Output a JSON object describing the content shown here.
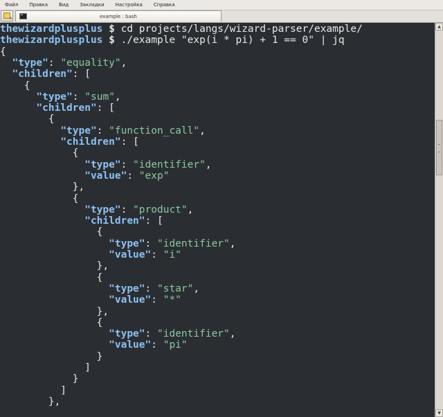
{
  "menu": [
    "Файл",
    "Правка",
    "Вид",
    "Закладки",
    "Настройка",
    "Справка"
  ],
  "tab": {
    "title": "example : bash"
  },
  "terminal": {
    "prompt": "thewizardplusplus",
    "commands": [
      "cd projects/langs/wizard-parser/example/",
      "./example \"exp(i * pi) + 1 == 0\" | jq"
    ],
    "output": [
      [
        [
          "p",
          "{"
        ]
      ],
      [
        [
          "p",
          "  "
        ],
        [
          "k",
          "\"type\""
        ],
        [
          "p",
          ": "
        ],
        [
          "s",
          "\"equality\""
        ],
        [
          "p",
          ","
        ]
      ],
      [
        [
          "p",
          "  "
        ],
        [
          "k",
          "\"children\""
        ],
        [
          "p",
          ": ["
        ]
      ],
      [
        [
          "p",
          "    {"
        ]
      ],
      [
        [
          "p",
          "      "
        ],
        [
          "k",
          "\"type\""
        ],
        [
          "p",
          ": "
        ],
        [
          "s",
          "\"sum\""
        ],
        [
          "p",
          ","
        ]
      ],
      [
        [
          "p",
          "      "
        ],
        [
          "k",
          "\"children\""
        ],
        [
          "p",
          ": ["
        ]
      ],
      [
        [
          "p",
          "        {"
        ]
      ],
      [
        [
          "p",
          "          "
        ],
        [
          "k",
          "\"type\""
        ],
        [
          "p",
          ": "
        ],
        [
          "s",
          "\"function_call\""
        ],
        [
          "p",
          ","
        ]
      ],
      [
        [
          "p",
          "          "
        ],
        [
          "k",
          "\"children\""
        ],
        [
          "p",
          ": ["
        ]
      ],
      [
        [
          "p",
          "            {"
        ]
      ],
      [
        [
          "p",
          "              "
        ],
        [
          "k",
          "\"type\""
        ],
        [
          "p",
          ": "
        ],
        [
          "s",
          "\"identifier\""
        ],
        [
          "p",
          ","
        ]
      ],
      [
        [
          "p",
          "              "
        ],
        [
          "k",
          "\"value\""
        ],
        [
          "p",
          ": "
        ],
        [
          "s",
          "\"exp\""
        ]
      ],
      [
        [
          "p",
          "            },"
        ]
      ],
      [
        [
          "p",
          "            {"
        ]
      ],
      [
        [
          "p",
          "              "
        ],
        [
          "k",
          "\"type\""
        ],
        [
          "p",
          ": "
        ],
        [
          "s",
          "\"product\""
        ],
        [
          "p",
          ","
        ]
      ],
      [
        [
          "p",
          "              "
        ],
        [
          "k",
          "\"children\""
        ],
        [
          "p",
          ": ["
        ]
      ],
      [
        [
          "p",
          "                {"
        ]
      ],
      [
        [
          "p",
          "                  "
        ],
        [
          "k",
          "\"type\""
        ],
        [
          "p",
          ": "
        ],
        [
          "s",
          "\"identifier\""
        ],
        [
          "p",
          ","
        ]
      ],
      [
        [
          "p",
          "                  "
        ],
        [
          "k",
          "\"value\""
        ],
        [
          "p",
          ": "
        ],
        [
          "s",
          "\"i\""
        ]
      ],
      [
        [
          "p",
          "                },"
        ]
      ],
      [
        [
          "p",
          "                {"
        ]
      ],
      [
        [
          "p",
          "                  "
        ],
        [
          "k",
          "\"type\""
        ],
        [
          "p",
          ": "
        ],
        [
          "s",
          "\"star\""
        ],
        [
          "p",
          ","
        ]
      ],
      [
        [
          "p",
          "                  "
        ],
        [
          "k",
          "\"value\""
        ],
        [
          "p",
          ": "
        ],
        [
          "s",
          "\"*\""
        ]
      ],
      [
        [
          "p",
          "                },"
        ]
      ],
      [
        [
          "p",
          "                {"
        ]
      ],
      [
        [
          "p",
          "                  "
        ],
        [
          "k",
          "\"type\""
        ],
        [
          "p",
          ": "
        ],
        [
          "s",
          "\"identifier\""
        ],
        [
          "p",
          ","
        ]
      ],
      [
        [
          "p",
          "                  "
        ],
        [
          "k",
          "\"value\""
        ],
        [
          "p",
          ": "
        ],
        [
          "s",
          "\"pi\""
        ]
      ],
      [
        [
          "p",
          "                }"
        ]
      ],
      [
        [
          "p",
          "              ]"
        ]
      ],
      [
        [
          "p",
          "            }"
        ]
      ],
      [
        [
          "p",
          "          ]"
        ]
      ],
      [
        [
          "p",
          "        },"
        ]
      ]
    ]
  },
  "colors": {
    "terminal_bg": "#2a2e33",
    "prompt": "#8fc1f2",
    "key": "#8fc1f2",
    "string": "#8dc89e",
    "text": "#e8e8e8"
  },
  "icons": {
    "new_tab": "new-tab-icon",
    "terminal": "terminal-icon",
    "scroll_up": "scroll-up-arrow-icon",
    "scroll_down": "scroll-down-arrow-icon"
  }
}
